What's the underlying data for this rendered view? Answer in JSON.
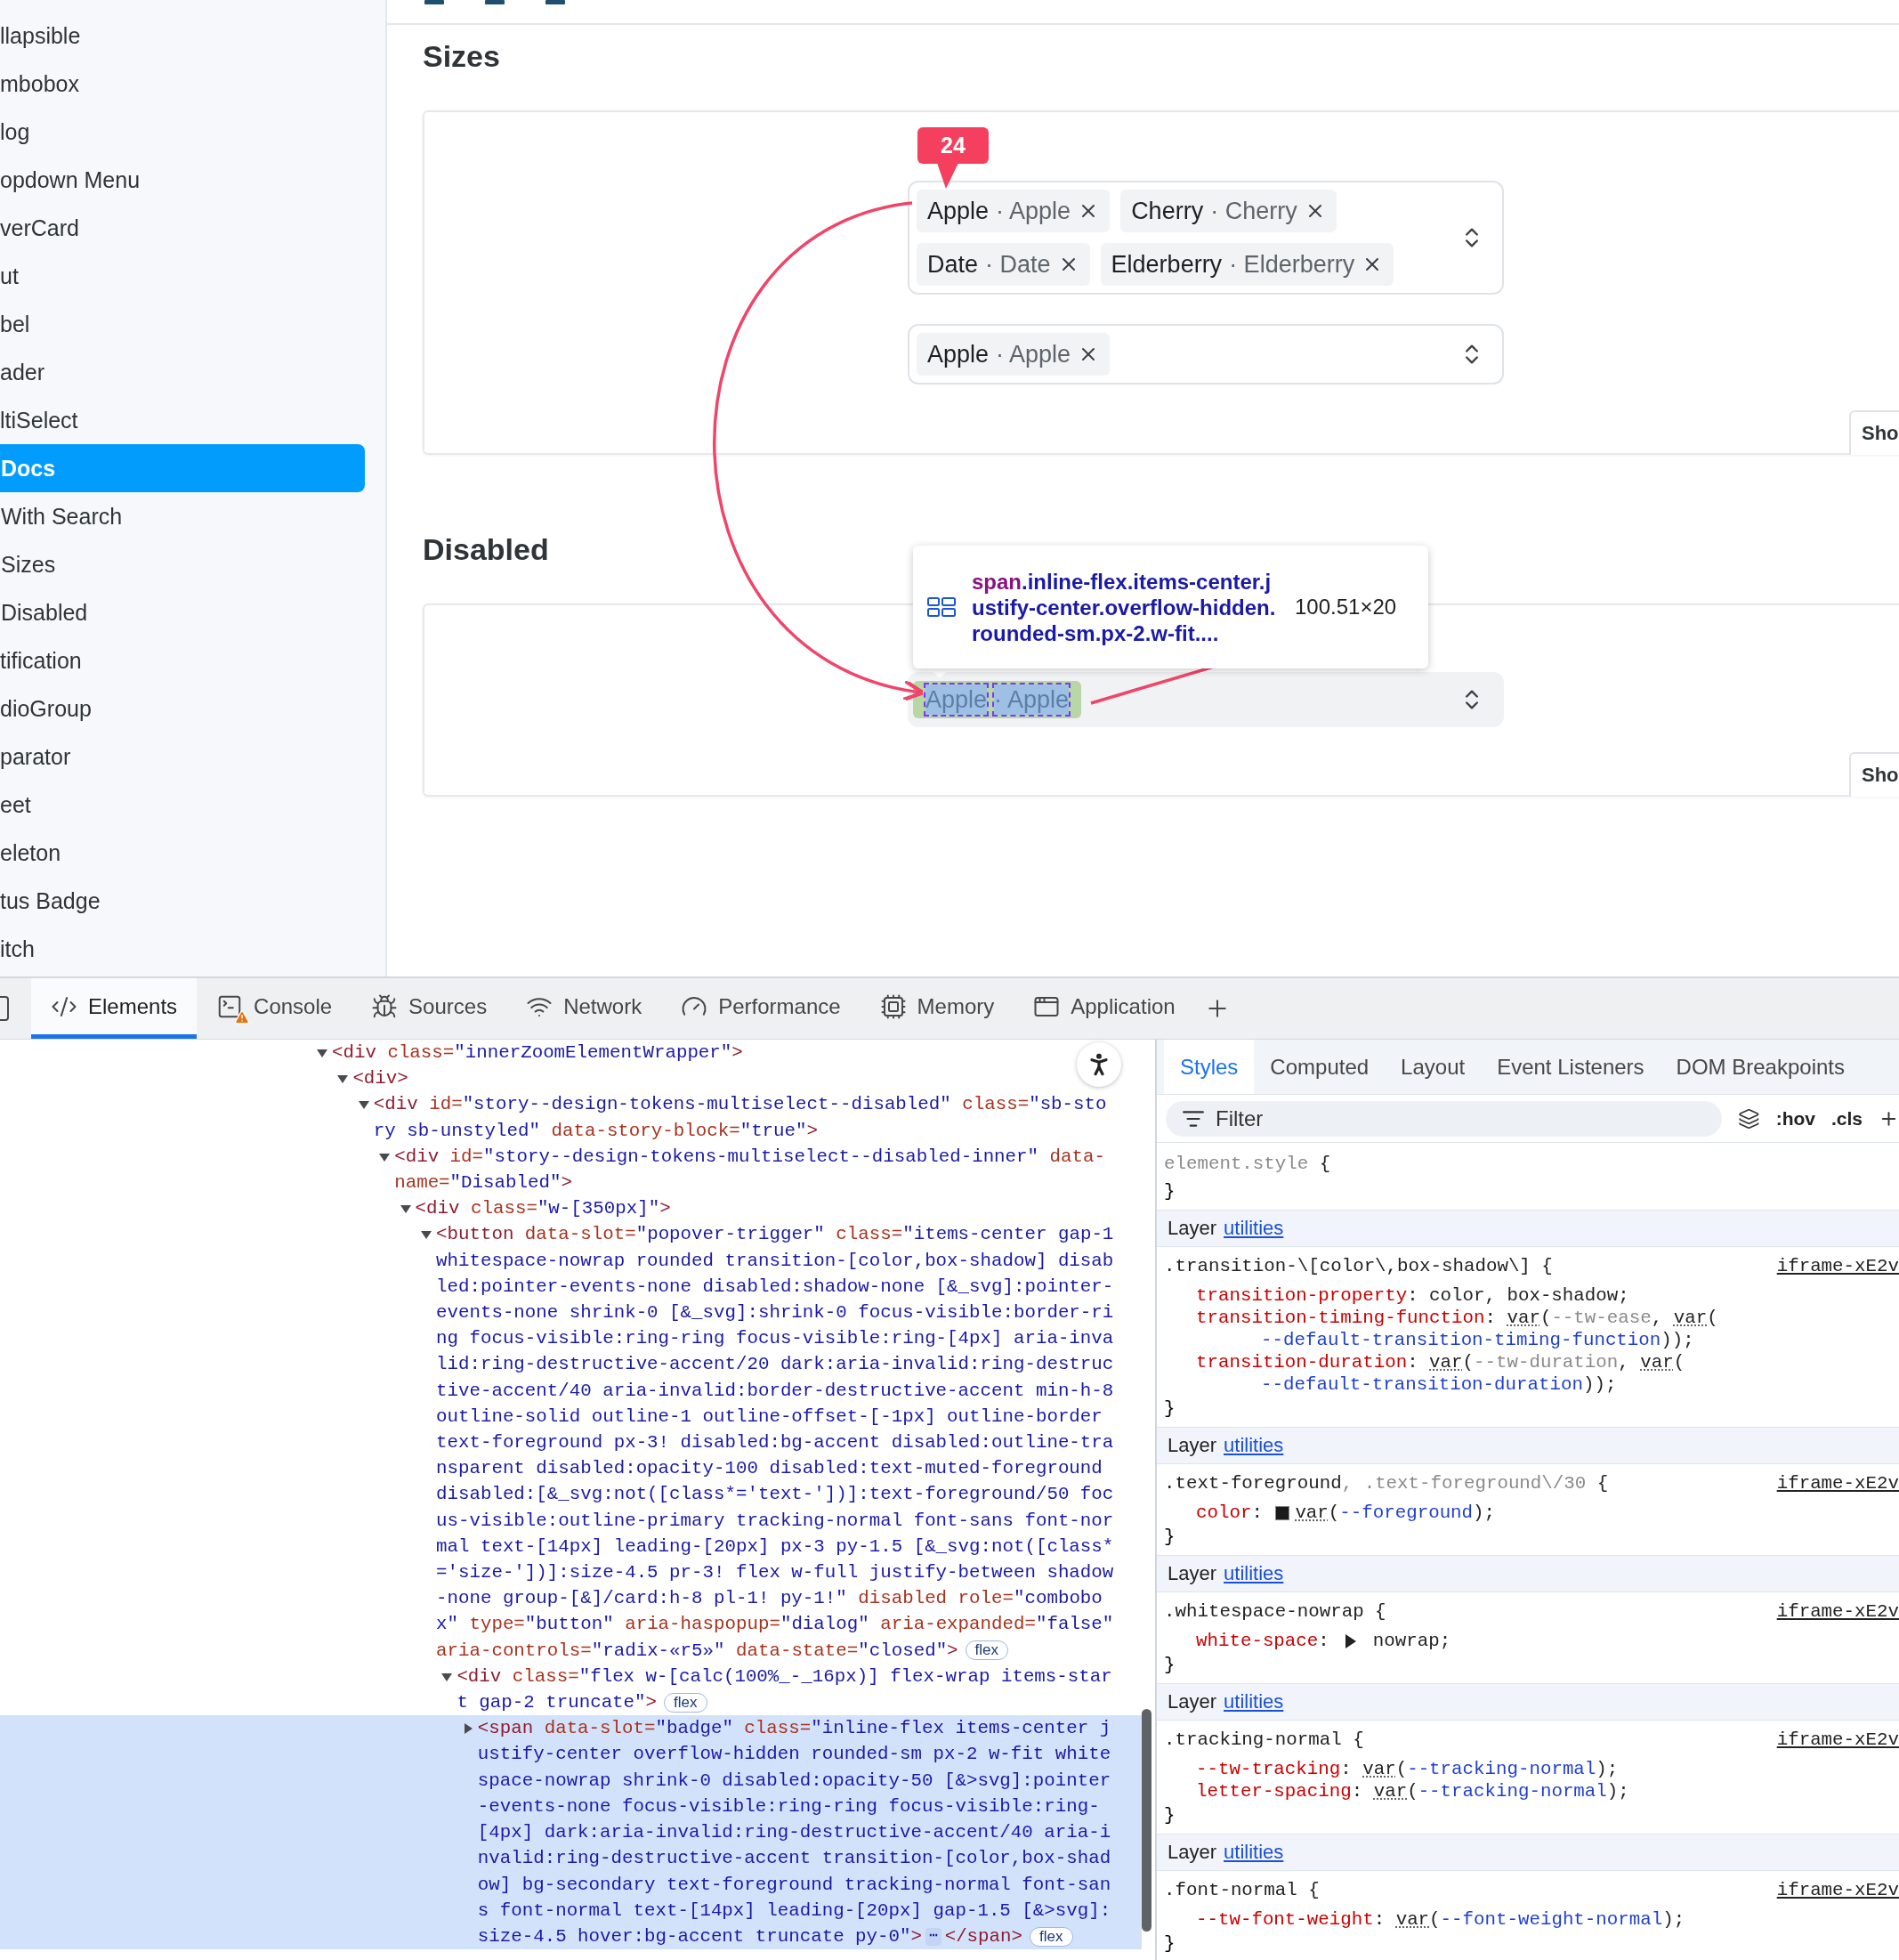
{
  "sidebar": {
    "items": [
      {
        "label": "llapsible",
        "selected": false
      },
      {
        "label": "mbobox",
        "selected": false
      },
      {
        "label": "log",
        "selected": false
      },
      {
        "label": "opdown Menu",
        "selected": false
      },
      {
        "label": "verCard",
        "selected": false
      },
      {
        "label": "ut",
        "selected": false
      },
      {
        "label": "bel",
        "selected": false
      },
      {
        "label": "ader",
        "selected": false
      },
      {
        "label": "ltiSelect",
        "selected": false,
        "children": [
          {
            "label": "Docs",
            "selected": true
          },
          {
            "label": "With Search",
            "selected": false
          },
          {
            "label": "Sizes",
            "selected": false
          },
          {
            "label": "Disabled",
            "selected": false
          }
        ]
      },
      {
        "label": "tification",
        "selected": false
      },
      {
        "label": "dioGroup",
        "selected": false
      },
      {
        "label": "parator",
        "selected": false
      },
      {
        "label": "eet",
        "selected": false
      },
      {
        "label": "eleton",
        "selected": false
      },
      {
        "label": "tus Badge",
        "selected": false
      },
      {
        "label": "itch",
        "selected": false
      }
    ]
  },
  "main": {
    "sections": [
      {
        "title": "Sizes",
        "show_button": "Sho",
        "selects": [
          {
            "disabled": false,
            "chips": [
              {
                "label": "Apple",
                "value": "· Apple",
                "inspected": false
              },
              {
                "label": "Cherry",
                "value": "· Cherry",
                "inspected": false
              },
              {
                "label": "Date",
                "value": "· Date",
                "inspected": false
              },
              {
                "label": "Elderberry",
                "value": "· Elderberry",
                "inspected": false
              }
            ]
          },
          {
            "disabled": false,
            "chips": [
              {
                "label": "Apple",
                "value": "· Apple",
                "inspected": false
              }
            ]
          }
        ]
      },
      {
        "title": "Disabled",
        "show_button": "Sho",
        "selects": [
          {
            "disabled": true,
            "chips": [
              {
                "label": "Apple",
                "value": "· Apple",
                "inspected": true
              }
            ]
          }
        ]
      }
    ]
  },
  "annotation": {
    "badge": "24"
  },
  "inspector_tooltip": {
    "tag": "span",
    "classes": ".inline-flex.items-center.justify-center.overflow-hidden.rounded-sm.px-2.w-fit....",
    "size": "100.51×20"
  },
  "devtools": {
    "tabs": [
      {
        "label": "Elements",
        "kind": "code",
        "selected": true,
        "warning": false
      },
      {
        "label": "Console",
        "kind": "console",
        "selected": false,
        "warning": true
      },
      {
        "label": "Sources",
        "kind": "bug",
        "selected": false,
        "warning": false
      },
      {
        "label": "Network",
        "kind": "wifi",
        "selected": false,
        "warning": false
      },
      {
        "label": "Performance",
        "kind": "gauge",
        "selected": false,
        "warning": false
      },
      {
        "label": "Memory",
        "kind": "chip",
        "selected": false,
        "warning": false
      },
      {
        "label": "Application",
        "kind": "window",
        "selected": false,
        "warning": false
      }
    ]
  },
  "elements": {
    "nodes": [
      {
        "expanded": true,
        "selected": false,
        "lines": [
          [
            {
              "kind": "tag",
              "text": "<div"
            },
            {
              "kind": "attr",
              "text": " class="
            },
            {
              "kind": "val",
              "text": "\"innerZoomElementWrapper\""
            },
            {
              "kind": "tag",
              "text": ">"
            }
          ]
        ],
        "children": [
          {
            "expanded": true,
            "selected": false,
            "lines": [
              [
                {
                  "kind": "tag",
                  "text": "<div>"
                }
              ]
            ],
            "children": [
              {
                "expanded": true,
                "selected": false,
                "lines": [
                  [
                    {
                      "kind": "tag",
                      "text": "<div"
                    },
                    {
                      "kind": "attr",
                      "text": " id="
                    },
                    {
                      "kind": "val",
                      "text": "\"story--design-tokens-multiselect--disabled\""
                    },
                    {
                      "kind": "attr",
                      "text": " class="
                    },
                    {
                      "kind": "val",
                      "text": "\"sb-sto"
                    }
                  ],
                  [
                    {
                      "kind": "val",
                      "text": "ry sb-unstyled\""
                    },
                    {
                      "kind": "attr",
                      "text": " data-story-block="
                    },
                    {
                      "kind": "val",
                      "text": "\"true\""
                    },
                    {
                      "kind": "tag",
                      "text": ">"
                    }
                  ]
                ],
                "children": [
                  {
                    "expanded": true,
                    "selected": false,
                    "lines": [
                      [
                        {
                          "kind": "tag",
                          "text": "<div"
                        },
                        {
                          "kind": "attr",
                          "text": " id="
                        },
                        {
                          "kind": "val",
                          "text": "\"story--design-tokens-multiselect--disabled-inner\""
                        },
                        {
                          "kind": "attr",
                          "text": " data-"
                        }
                      ],
                      [
                        {
                          "kind": "attr",
                          "text": "name="
                        },
                        {
                          "kind": "val",
                          "text": "\"Disabled\""
                        },
                        {
                          "kind": "tag",
                          "text": ">"
                        }
                      ]
                    ],
                    "children": [
                      {
                        "expanded": true,
                        "selected": false,
                        "lines": [
                          [
                            {
                              "kind": "tag",
                              "text": "<div"
                            },
                            {
                              "kind": "attr",
                              "text": " class="
                            },
                            {
                              "kind": "val",
                              "text": "\"w-[350px]\""
                            },
                            {
                              "kind": "tag",
                              "text": ">"
                            }
                          ]
                        ],
                        "children": [
                          {
                            "expanded": true,
                            "selected": false,
                            "lines": [
                              [
                                {
                                  "kind": "tag",
                                  "text": "<button"
                                },
                                {
                                  "kind": "attr",
                                  "text": " data-slot="
                                },
                                {
                                  "kind": "val",
                                  "text": "\"popover-trigger\""
                                },
                                {
                                  "kind": "attr",
                                  "text": " class="
                                },
                                {
                                  "kind": "val",
                                  "text": "\"items-center gap-1"
                                }
                              ],
                              [
                                {
                                  "kind": "val",
                                  "text": "whitespace-nowrap rounded transition-[color,box-shadow] disab"
                                }
                              ],
                              [
                                {
                                  "kind": "val",
                                  "text": "led:pointer-events-none disabled:shadow-none [&_svg]:pointer-"
                                }
                              ],
                              [
                                {
                                  "kind": "val",
                                  "text": "events-none shrink-0 [&_svg]:shrink-0 focus-visible:border-ri"
                                }
                              ],
                              [
                                {
                                  "kind": "val",
                                  "text": "ng focus-visible:ring-ring focus-visible:ring-[4px] aria-inva"
                                }
                              ],
                              [
                                {
                                  "kind": "val",
                                  "text": "lid:ring-destructive-accent/20 dark:aria-invalid:ring-destruc"
                                }
                              ],
                              [
                                {
                                  "kind": "val",
                                  "text": "tive-accent/40 aria-invalid:border-destructive-accent min-h-8"
                                }
                              ],
                              [
                                {
                                  "kind": "val",
                                  "text": "outline-solid outline-1 outline-offset-[-1px] outline-border"
                                }
                              ],
                              [
                                {
                                  "kind": "val",
                                  "text": "text-foreground px-3! disabled:bg-accent disabled:outline-tra"
                                }
                              ],
                              [
                                {
                                  "kind": "val",
                                  "text": "nsparent disabled:opacity-100 disabled:text-muted-foreground"
                                }
                              ],
                              [
                                {
                                  "kind": "val",
                                  "text": "disabled:[&_svg:not([class*='text-'])]:text-foreground/50 foc"
                                }
                              ],
                              [
                                {
                                  "kind": "val",
                                  "text": "us-visible:outline-primary tracking-normal font-sans font-nor"
                                }
                              ],
                              [
                                {
                                  "kind": "val",
                                  "text": "mal text-[14px] leading-[20px] px-3 py-1.5 [&_svg:not([class*"
                                }
                              ],
                              [
                                {
                                  "kind": "val",
                                  "text": "='size-'])]:size-4.5 pr-3! flex w-full justify-between shadow"
                                }
                              ],
                              [
                                {
                                  "kind": "val",
                                  "text": "-none group-[&]/card:h-8 pl-1! py-1!\""
                                },
                                {
                                  "kind": "attr",
                                  "text": " disabled role="
                                },
                                {
                                  "kind": "val",
                                  "text": "\"combobo"
                                }
                              ],
                              [
                                {
                                  "kind": "val",
                                  "text": "x\""
                                },
                                {
                                  "kind": "attr",
                                  "text": " type="
                                },
                                {
                                  "kind": "val",
                                  "text": "\"button\""
                                },
                                {
                                  "kind": "attr",
                                  "text": " aria-haspopup="
                                },
                                {
                                  "kind": "val",
                                  "text": "\"dialog\""
                                },
                                {
                                  "kind": "attr",
                                  "text": " aria-expanded="
                                },
                                {
                                  "kind": "val",
                                  "text": "\"false\""
                                }
                              ],
                              [
                                {
                                  "kind": "attr",
                                  "text": "aria-controls="
                                },
                                {
                                  "kind": "val",
                                  "text": "\"radix-«r5»\""
                                },
                                {
                                  "kind": "attr",
                                  "text": " data-state="
                                },
                                {
                                  "kind": "val",
                                  "text": "\"closed\""
                                },
                                {
                                  "kind": "tag",
                                  "text": ">"
                                },
                                {
                                  "kind": "badge",
                                  "text": "flex"
                                }
                              ]
                            ],
                            "children": [
                              {
                                "expanded": true,
                                "selected": false,
                                "lines": [
                                  [
                                    {
                                      "kind": "tag",
                                      "text": "<div"
                                    },
                                    {
                                      "kind": "attr",
                                      "text": " class="
                                    },
                                    {
                                      "kind": "val",
                                      "text": "\"flex w-[calc(100%_-_16px)] flex-wrap items-star"
                                    }
                                  ],
                                  [
                                    {
                                      "kind": "val",
                                      "text": "t gap-2 truncate\""
                                    },
                                    {
                                      "kind": "tag",
                                      "text": ">"
                                    },
                                    {
                                      "kind": "badge",
                                      "text": "flex"
                                    }
                                  ]
                                ],
                                "children": [
                                  {
                                    "expanded": false,
                                    "selected": true,
                                    "lines": [
                                      [
                                        {
                                          "kind": "tag",
                                          "text": "<span"
                                        },
                                        {
                                          "kind": "attr",
                                          "text": " data-slot="
                                        },
                                        {
                                          "kind": "val",
                                          "text": "\"badge\""
                                        },
                                        {
                                          "kind": "attr",
                                          "text": " class="
                                        },
                                        {
                                          "kind": "val",
                                          "text": "\"inline-flex items-center j"
                                        }
                                      ],
                                      [
                                        {
                                          "kind": "val",
                                          "text": "ustify-center overflow-hidden rounded-sm px-2 w-fit white"
                                        }
                                      ],
                                      [
                                        {
                                          "kind": "val",
                                          "text": "space-nowrap shrink-0 disabled:opacity-50 [&>svg]:pointer"
                                        }
                                      ],
                                      [
                                        {
                                          "kind": "val",
                                          "text": "-events-none focus-visible:ring-ring focus-visible:ring-"
                                        }
                                      ],
                                      [
                                        {
                                          "kind": "val",
                                          "text": "[4px] dark:aria-invalid:ring-destructive-accent/40 aria-i"
                                        }
                                      ],
                                      [
                                        {
                                          "kind": "val",
                                          "text": "nvalid:ring-destructive-accent transition-[color,box-shad"
                                        }
                                      ],
                                      [
                                        {
                                          "kind": "val",
                                          "text": "ow] bg-secondary text-foreground tracking-normal font-san"
                                        }
                                      ],
                                      [
                                        {
                                          "kind": "val",
                                          "text": "s font-normal text-[14px] leading-[20px] gap-1.5 [&>svg]:"
                                        }
                                      ],
                                      [
                                        {
                                          "kind": "val",
                                          "text": "size-4.5 hover:bg-accent truncate py-0\""
                                        },
                                        {
                                          "kind": "tag",
                                          "text": ">"
                                        },
                                        {
                                          "kind": "more",
                                          "text": "⋯"
                                        },
                                        {
                                          "kind": "tag",
                                          "text": "</span>"
                                        },
                                        {
                                          "kind": "badge",
                                          "text": "flex"
                                        }
                                      ]
                                    ]
                                  }
                                ]
                              }
                            ]
                          }
                        ]
                      }
                    ]
                  }
                ]
              }
            ]
          }
        ]
      }
    ]
  },
  "styles": {
    "tabs": [
      {
        "label": "Styles",
        "selected": true
      },
      {
        "label": "Computed",
        "selected": false
      },
      {
        "label": "Layout",
        "selected": false
      },
      {
        "label": "Event Listeners",
        "selected": false
      },
      {
        "label": "DOM Breakpoints",
        "selected": false
      }
    ],
    "filter": {
      "placeholder": "Filter"
    },
    "toggles": [
      ":hov",
      ".cls"
    ],
    "rules": [
      {
        "selector": [
          {
            "kind": "muted",
            "text": "element.style"
          },
          {
            "kind": "plain",
            "text": " {"
          }
        ],
        "close": "}"
      },
      {
        "layer": {
          "label": "Layer",
          "name": "utilities"
        },
        "selector": [
          {
            "kind": "plain",
            "text": ".transition-\\[color\\,box-shadow\\] {"
          }
        ],
        "source": "iframe-xE2v",
        "declarations": [
          {
            "continued": false,
            "segs": [
              {
                "kind": "prop",
                "text": "transition-property"
              },
              {
                "kind": "plain",
                "text": ": color, box-shadow;"
              }
            ]
          },
          {
            "continued": false,
            "segs": [
              {
                "kind": "prop",
                "text": "transition-timing-function"
              },
              {
                "kind": "plain",
                "text": ": "
              },
              {
                "kind": "fn",
                "text": "var"
              },
              {
                "kind": "plain",
                "text": "("
              },
              {
                "kind": "muted",
                "text": "--tw-ease"
              },
              {
                "kind": "plain",
                "text": ", "
              },
              {
                "kind": "fn",
                "text": "var"
              },
              {
                "kind": "plain",
                "text": "("
              }
            ]
          },
          {
            "continued": true,
            "segs": [
              {
                "kind": "var",
                "text": "--default-transition-timing-function"
              },
              {
                "kind": "plain",
                "text": "));"
              }
            ]
          },
          {
            "continued": false,
            "segs": [
              {
                "kind": "prop",
                "text": "transition-duration"
              },
              {
                "kind": "plain",
                "text": ": "
              },
              {
                "kind": "fn",
                "text": "var"
              },
              {
                "kind": "plain",
                "text": "("
              },
              {
                "kind": "muted",
                "text": "--tw-duration"
              },
              {
                "kind": "plain",
                "text": ", "
              },
              {
                "kind": "fn",
                "text": "var"
              },
              {
                "kind": "plain",
                "text": "("
              }
            ]
          },
          {
            "continued": true,
            "segs": [
              {
                "kind": "var",
                "text": "--default-transition-duration"
              },
              {
                "kind": "plain",
                "text": "));"
              }
            ]
          }
        ],
        "close": "}"
      },
      {
        "layer": {
          "label": "Layer",
          "name": "utilities"
        },
        "selector": [
          {
            "kind": "plain",
            "text": ".text-foreground"
          },
          {
            "kind": "muted",
            "text": ", .text-foreground\\/30"
          },
          {
            "kind": "plain",
            "text": " {"
          }
        ],
        "source": "iframe-xE2v",
        "declarations": [
          {
            "continued": false,
            "segs": [
              {
                "kind": "prop",
                "text": "color"
              },
              {
                "kind": "plain",
                "text": ": "
              },
              {
                "kind": "swatch"
              },
              {
                "kind": "fn",
                "text": "var"
              },
              {
                "kind": "plain",
                "text": "("
              },
              {
                "kind": "var",
                "text": "--foreground"
              },
              {
                "kind": "plain",
                "text": ");"
              }
            ]
          }
        ],
        "close": "}"
      },
      {
        "layer": {
          "label": "Layer",
          "name": "utilities"
        },
        "selector": [
          {
            "kind": "plain",
            "text": ".whitespace-nowrap {"
          }
        ],
        "source": "iframe-xE2v",
        "declarations": [
          {
            "continued": false,
            "segs": [
              {
                "kind": "prop",
                "text": "white-space"
              },
              {
                "kind": "plain",
                "text": ": "
              },
              {
                "kind": "toggle"
              },
              {
                "kind": "plain",
                "text": " nowrap;"
              }
            ]
          }
        ],
        "close": "}"
      },
      {
        "layer": {
          "label": "Layer",
          "name": "utilities"
        },
        "selector": [
          {
            "kind": "plain",
            "text": ".tracking-normal {"
          }
        ],
        "source": "iframe-xE2v",
        "declarations": [
          {
            "continued": false,
            "segs": [
              {
                "kind": "prop",
                "text": "--tw-tracking"
              },
              {
                "kind": "plain",
                "text": ": "
              },
              {
                "kind": "fn",
                "text": "var"
              },
              {
                "kind": "plain",
                "text": "("
              },
              {
                "kind": "var",
                "text": "--tracking-normal"
              },
              {
                "kind": "plain",
                "text": ");"
              }
            ]
          },
          {
            "continued": false,
            "segs": [
              {
                "kind": "prop",
                "text": "letter-spacing"
              },
              {
                "kind": "plain",
                "text": ": "
              },
              {
                "kind": "fn",
                "text": "var"
              },
              {
                "kind": "plain",
                "text": "("
              },
              {
                "kind": "var",
                "text": "--tracking-normal"
              },
              {
                "kind": "plain",
                "text": ");"
              }
            ]
          }
        ],
        "close": "}"
      },
      {
        "layer": {
          "label": "Layer",
          "name": "utilities"
        },
        "selector": [
          {
            "kind": "plain",
            "text": ".font-normal {"
          }
        ],
        "source": "iframe-xE2v",
        "declarations": [
          {
            "continued": false,
            "segs": [
              {
                "kind": "prop",
                "text": "--tw-font-weight"
              },
              {
                "kind": "plain",
                "text": ": "
              },
              {
                "kind": "fn",
                "text": "var"
              },
              {
                "kind": "plain",
                "text": "("
              },
              {
                "kind": "var",
                "text": "--font-weight-normal"
              },
              {
                "kind": "plain",
                "text": ");"
              }
            ]
          }
        ],
        "close": "}"
      }
    ]
  }
}
